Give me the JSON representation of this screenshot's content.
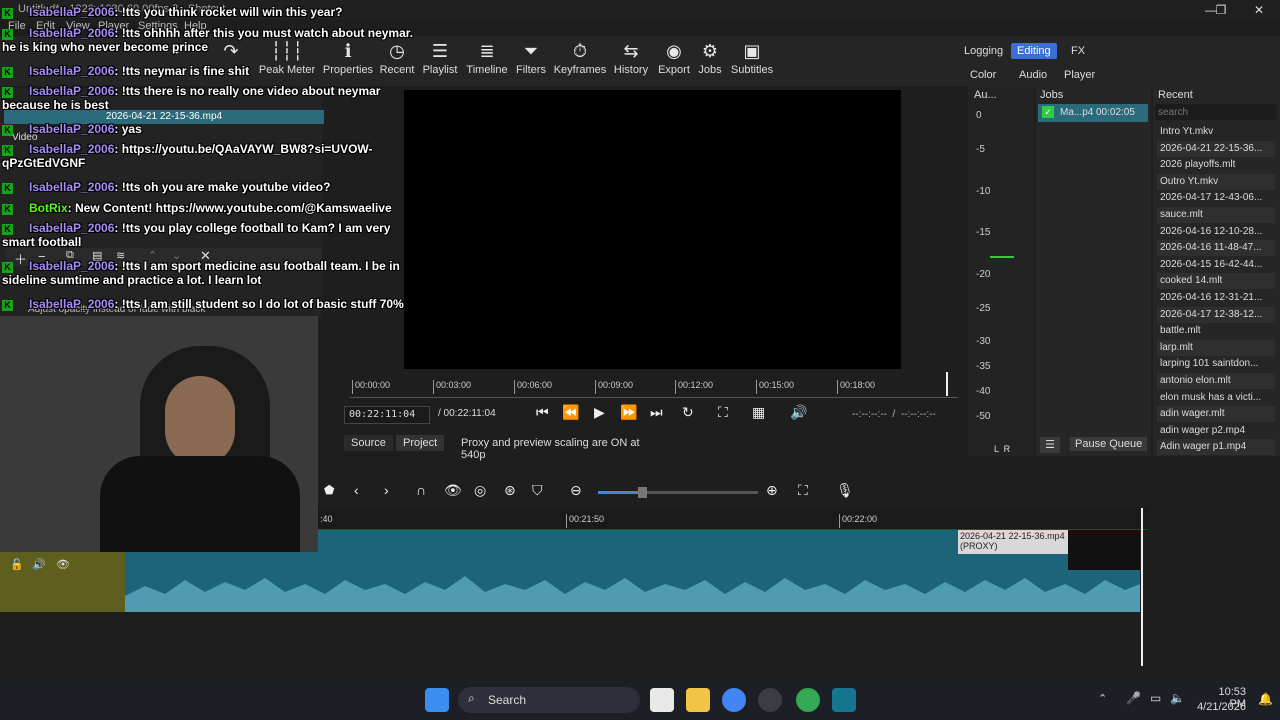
{
  "window": {
    "title": "Untitled* - 1920x1080 60.00fps 3 - Shotcut"
  },
  "menu": [
    "File",
    "Edit",
    "View",
    "Player",
    "Settings",
    "Help"
  ],
  "toolbar": {
    "items": [
      {
        "label": "Peak Meter",
        "icon": "peak-meter-icon"
      },
      {
        "label": "Properties",
        "icon": "properties-icon"
      },
      {
        "label": "Recent",
        "icon": "recent-icon"
      },
      {
        "label": "Playlist",
        "icon": "playlist-icon"
      },
      {
        "label": "Timeline",
        "icon": "timeline-icon"
      },
      {
        "label": "Filters",
        "icon": "filter-icon"
      },
      {
        "label": "Keyframes",
        "icon": "keyframes-icon"
      },
      {
        "label": "History",
        "icon": "history-icon"
      },
      {
        "label": "Export",
        "icon": "export-icon"
      },
      {
        "label": "Jobs",
        "icon": "gear-icon"
      },
      {
        "label": "Subtitles",
        "icon": "subtitles-icon"
      }
    ],
    "workspaces": {
      "logging": "Logging",
      "editing": "Editing",
      "fx": "FX",
      "color": "Color",
      "audio": "Audio",
      "player": "Player"
    }
  },
  "left_panel": {
    "file_name": "2026-04-21 22-15-36.mp4",
    "tab": "Video",
    "hint": "Adjust opacity instead of fade with black"
  },
  "player": {
    "ruler": [
      "00:00:00",
      "00:03:00",
      "00:06:00",
      "00:09:00",
      "00:12:00",
      "00:15:00",
      "00:18:00"
    ],
    "current": "00:22:11:04",
    "total": "/ 00:22:11:04",
    "in_out": "--:--:--:--  /  --:--:--:--",
    "source_tab": "Source",
    "project_tab": "Project",
    "status": "Proxy and preview scaling are ON at 540p"
  },
  "audio_meter": {
    "title": "Au...",
    "levels": [
      "0",
      "-5",
      "-10",
      "-15",
      "-20",
      "-25",
      "-30",
      "-35",
      "-40",
      "-50"
    ],
    "channels": "L  R"
  },
  "jobs": {
    "title": "Jobs",
    "job_name": "Ma...p4",
    "job_time": "00:02:05",
    "pause_label": "Pause Queue",
    "menu_label": "☰"
  },
  "recent": {
    "title": "Recent",
    "search_placeholder": "search",
    "items": [
      "Intro Yt.mkv",
      "2026-04-21 22-15-36...",
      "2026 playoffs.mlt",
      "Outro Yt.mkv",
      "2026-04-17 12-43-06...",
      "sauce.mlt",
      "2026-04-16 12-10-28...",
      "2026-04-16 11-48-47...",
      "2026-04-15 16-42-44...",
      "cooked 14.mlt",
      "2026-04-16 12-31-21...",
      "2026-04-17 12-38-12...",
      "battle.mlt",
      "larp.mlt",
      "larping 101 saintdon...",
      "antonio elon.mlt",
      "elon musk has a victi...",
      "adin wager.mlt",
      "adin wager p2.mp4",
      "Adin wager p1.mp4"
    ]
  },
  "timeline": {
    "ruler": [
      ":40",
      "00:21:50",
      "00:22:00"
    ],
    "clip_label": "2026-04-21 22-15-36.mp4",
    "clip_sub": "(PROXY)"
  },
  "chat": [
    {
      "user": "IsabellaP_2006",
      "text": ": !tts you think rocket will win this year?"
    },
    {
      "user": "IsabellaP_2006",
      "text": ": !tts ohhhh after this you must watch about neymar. he is king who never become prince"
    },
    {
      "user": "IsabellaP_2006",
      "text": ": !tts neymar is fine shit"
    },
    {
      "user": "IsabellaP_2006",
      "text": ": !tts there is no really one video about neymar because he is best"
    },
    {
      "user": "IsabellaP_2006",
      "text": ": yas"
    },
    {
      "user": "IsabellaP_2006",
      "text": ": https://youtu.be/QAaVAYW_BW8?si=UVOW-qPzGtEdVGNF"
    },
    {
      "user": "IsabellaP_2006",
      "text": ": !tts oh you are make youtube video?"
    },
    {
      "user": "BotRix",
      "text": ": New Content! https://www.youtube.com/@Kamswaelive"
    },
    {
      "user": "IsabellaP_2006",
      "text": ": !tts you play college football to Kam? I am very smart football"
    },
    {
      "user": "IsabellaP_2006",
      "text": ": !tts I am sport medicine asu football team. I be in sideline sumtime and practice a lot. I learn lot"
    },
    {
      "user": "IsabellaP_2006",
      "text": ": !tts I am still student so I do lot of basic stuff 70%"
    }
  ],
  "taskbar": {
    "search_label": "Search",
    "time": "10:53 PM",
    "date": "4/21/2026"
  }
}
